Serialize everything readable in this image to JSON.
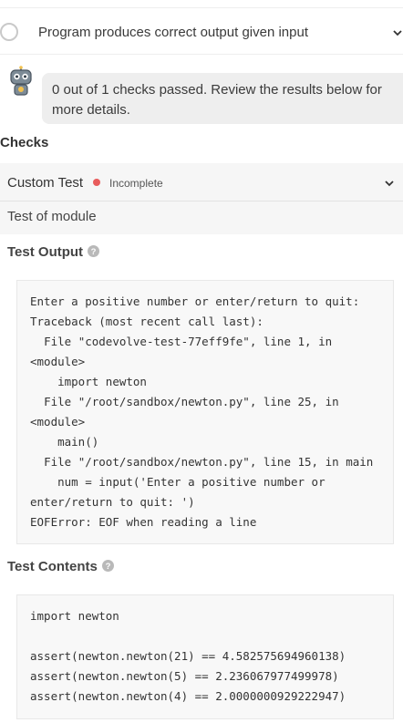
{
  "task": {
    "title": "Program produces correct output given input",
    "icons": {
      "status": "empty-circle-icon",
      "toggle": "chevron-down-icon"
    }
  },
  "assistant": {
    "icon": "robot-icon",
    "message": "0 out of 1 checks passed. Review the results below for more details."
  },
  "checks": {
    "title": "Checks",
    "items": [
      {
        "name": "Custom Test",
        "status": "Incomplete",
        "status_color": "#e85c5c",
        "description": "Test of module",
        "output_label": "Test Output",
        "output": "Enter a positive number or enter/return to quit:\nTraceback (most recent call last):\n  File \"codevolve-test-77eff9fe\", line 1, in\n<module>\n    import newton\n  File \"/root/sandbox/newton.py\", line 25, in\n<module>\n    main()\n  File \"/root/sandbox/newton.py\", line 15, in main\n    num = input('Enter a positive number or\nenter/return to quit: ')\nEOFError: EOF when reading a line",
        "contents_label": "Test Contents",
        "contents": "import newton\n\nassert(newton.newton(21) == 4.582575694960138)\nassert(newton.newton(5) == 2.236067977499978)\nassert(newton.newton(4) == 2.0000000929222947)"
      }
    ]
  }
}
